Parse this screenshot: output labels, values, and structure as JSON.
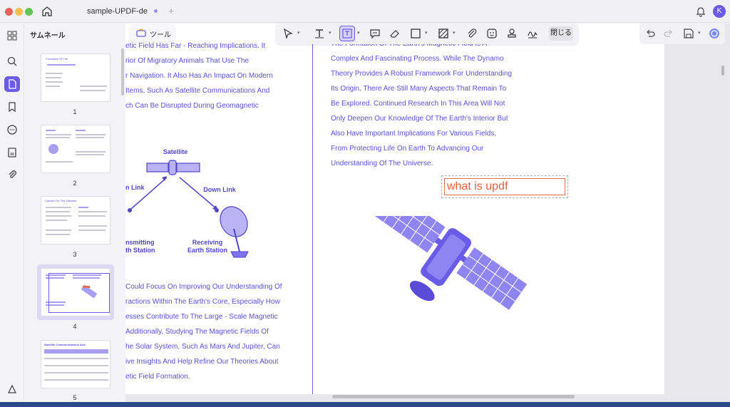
{
  "window": {
    "tab_title": "sample-UPDF-de",
    "tab_add": "+",
    "avatar_initial": "K"
  },
  "toolbar": {
    "tools_label": "ツール",
    "close_label": "閉じる",
    "active_tool": "text-box"
  },
  "thumbnails": {
    "title": "サムネール",
    "pages": [
      {
        "number": "1",
        "heading": "Formation Of The"
      },
      {
        "number": "2"
      },
      {
        "number": "3",
        "heading": "Causes For The Disturbs"
      },
      {
        "number": "4",
        "selected": true
      },
      {
        "number": "5",
        "heading": "Satellite Communications And"
      }
    ]
  },
  "left_page": {
    "top_lines": [
      "etic Field Has Far - Reaching Implications. It",
      "rior Of Migratory Animals That Use The",
      "r Navigation. It Also Has An Impact On Modern",
      "Items, Such As Satellite Communications And",
      "ch Can Be Disrupted During Geomagnetic"
    ],
    "diagram": {
      "satellite": "Satellite",
      "up_link": "n Link",
      "down_link": "Down Link",
      "transmitting_1": "nsmitting",
      "transmitting_2": "th Station",
      "receiving_1": "Receiving",
      "receiving_2": "Earth Station"
    },
    "bottom_lines": [
      "Could Focus On Improving Our Understanding Of",
      "ractions Within The Earth's Core, Especially How",
      "esses Contribute To The Large - Scale Magnetic",
      "Additionally, Studying The Magnetic Fields Of",
      "he Solar System, Such As Mars And Jupiter, Can",
      "ive Insights And Help Refine Our Theories About",
      "etic Field Formation."
    ]
  },
  "right_page": {
    "lines": [
      "The Formation Of The Earth's Magnetic Field Is A",
      "Complex And Fascinating Process. While The Dynamo",
      "Theory Provides A Robust Framework For Understanding",
      "Its Origin, There Are Still Many Aspects That Remain To",
      "Be Explored. Continued Research In This Area Will Not",
      "Only Deepen Our Knowledge Of The Earth's Interior But",
      "Also Have Important Implications For Various Fields,",
      "From Protecting Life On Earth To Advancing Our",
      "Understanding Of The Universe."
    ],
    "text_box_value": "what is updf"
  },
  "colors": {
    "accent": "#6b5ce7",
    "doc_text": "#5b4fd6",
    "textbox_border": "#e07050"
  }
}
